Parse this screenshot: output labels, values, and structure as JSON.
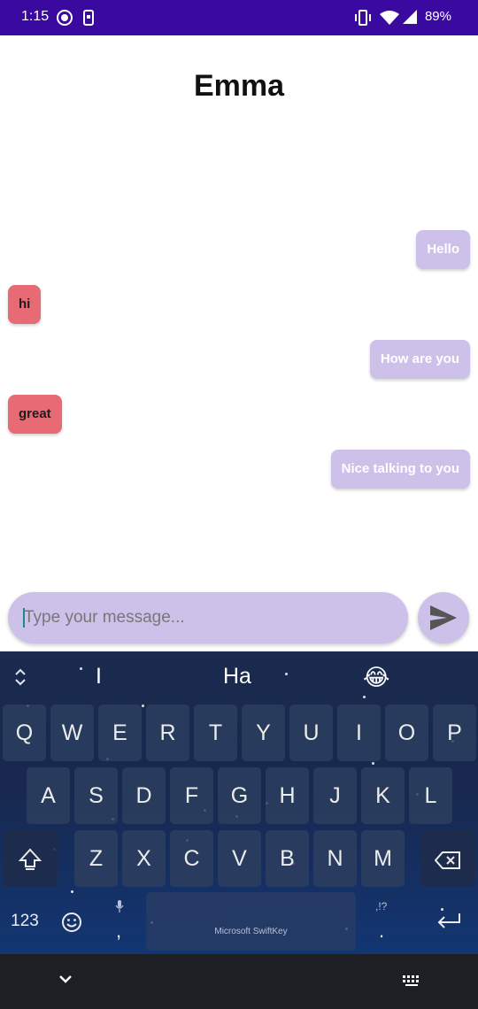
{
  "status_bar": {
    "time": "1:15",
    "battery_percent": "89%",
    "icons": [
      "record-icon",
      "phone-notification-icon",
      "vibrate-icon",
      "wifi-icon",
      "signal-icon",
      "battery-icon"
    ],
    "background": "#3a0aa0"
  },
  "chat": {
    "title": "Emma",
    "messages": [
      {
        "side": "sent",
        "text": "Hello"
      },
      {
        "side": "received",
        "text": "hi"
      },
      {
        "side": "sent",
        "text": "How are you"
      },
      {
        "side": "received",
        "text": "great"
      },
      {
        "side": "sent",
        "text": "Nice talking to you"
      }
    ],
    "sent_color": "#cdc1ea",
    "received_color": "#e86a75"
  },
  "composer": {
    "value": "",
    "placeholder": "Type your message...",
    "send_icon": "send-icon"
  },
  "keyboard": {
    "suggestions": [
      "I",
      "Ha",
      "😂"
    ],
    "row1": [
      "Q",
      "W",
      "E",
      "R",
      "T",
      "Y",
      "U",
      "I",
      "O",
      "P"
    ],
    "row2": [
      "A",
      "S",
      "D",
      "F",
      "G",
      "H",
      "J",
      "K",
      "L"
    ],
    "row3": [
      "Z",
      "X",
      "C",
      "V",
      "B",
      "N",
      "M"
    ],
    "numbers_key": "123",
    "comma_key": ",",
    "period_key": ".",
    "punct_hint": ",!?",
    "space_label": "Microsoft SwiftKey"
  },
  "nav_bar": {
    "icons": [
      "chevron-down-icon",
      "keyboard-icon"
    ]
  }
}
